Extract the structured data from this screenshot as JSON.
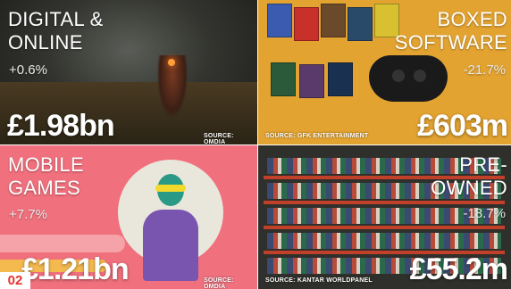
{
  "badge": {
    "label": "02"
  },
  "panels": [
    {
      "title": "DIGITAL &\nONLINE",
      "change": "+0.6%",
      "value": "£1.98bn",
      "source": "SOURCE: OMDIA"
    },
    {
      "title": "BOXED\nSOFTWARE",
      "change": "-21.7%",
      "value": "£603m",
      "source": "SOURCE: GFK ENTERTAINMENT"
    },
    {
      "title": "MOBILE\nGAMES",
      "change": "+7.7%",
      "value": "£1.21bn",
      "source": "SOURCE: OMDIA"
    },
    {
      "title": "PRE-\nOWNED",
      "change": "-18.7%",
      "value": "£55.2m",
      "source": "SOURCE: KANTAR WORLDPANEL"
    }
  ],
  "colors": {
    "accent": "#e8322c",
    "boxed_background": "#e2a331",
    "mobile_background": "#f0707d"
  }
}
